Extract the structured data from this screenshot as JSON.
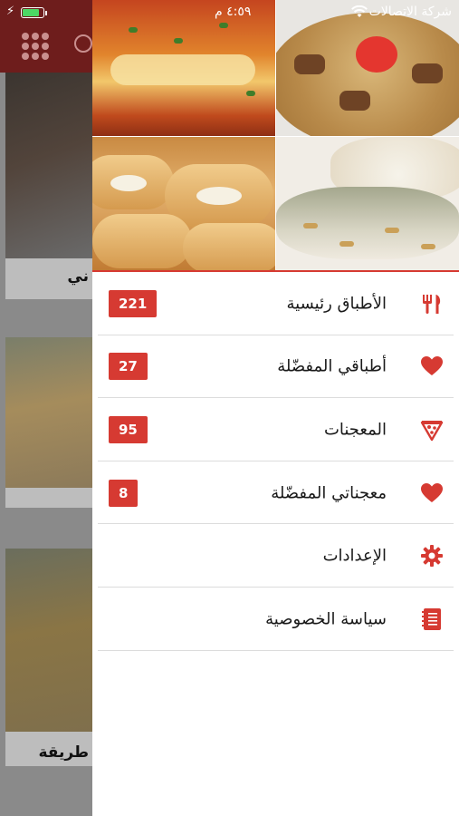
{
  "status_bar": {
    "time": "٤:٥٩ م",
    "carrier": "شركة الاتصالات",
    "battery_level": 0.8
  },
  "background": {
    "card_captions": [
      "ني",
      "طريقة"
    ]
  },
  "drawer": {
    "images": [
      "pizza-image",
      "rice-meat-image",
      "pastry-image",
      "fish-rice-image"
    ],
    "menu": [
      {
        "label": "الأطباق رئيسية",
        "badge": "221",
        "icon": "utensils-icon"
      },
      {
        "label": "أطباقي المفضّلة",
        "badge": "27",
        "icon": "heart-icon"
      },
      {
        "label": "المعجنات",
        "badge": "95",
        "icon": "pizza-slice-icon"
      },
      {
        "label": "معجناتي المفضّلة",
        "badge": "8",
        "icon": "heart-icon"
      },
      {
        "label": "الإعدادات",
        "badge": "",
        "icon": "gear-icon"
      },
      {
        "label": "سياسة الخصوصية",
        "badge": "",
        "icon": "document-icon"
      }
    ]
  },
  "colors": {
    "accent": "#d63a32",
    "header_dimmed": "#6e1d1c"
  }
}
